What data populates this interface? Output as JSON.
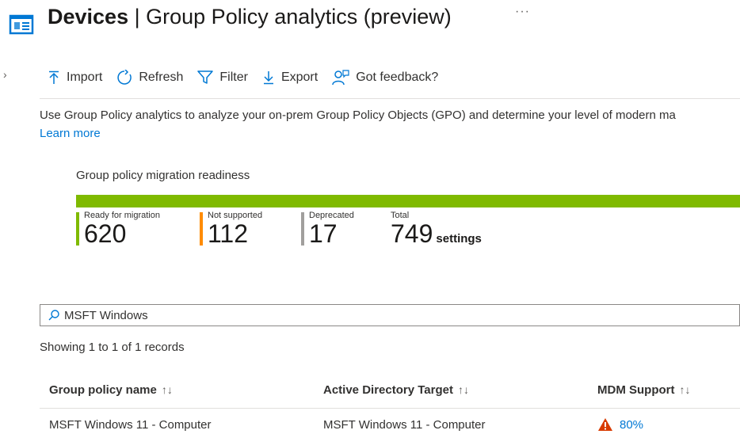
{
  "header": {
    "title_bold": "Devices",
    "separator": "|",
    "title_rest": "Group Policy analytics (preview)",
    "more": "···",
    "icon": "page-icon"
  },
  "nav": {
    "collapse_glyph": "›",
    "icon": "chevron-right-icon"
  },
  "toolbar": {
    "import_label": "Import",
    "refresh_label": "Refresh",
    "filter_label": "Filter",
    "export_label": "Export",
    "feedback_label": "Got feedback?"
  },
  "description": "Use Group Policy analytics to analyze your on-prem Group Policy Objects (GPO) and determine your level of modern ma",
  "learn_more": "Learn more",
  "readiness": {
    "title": "Group policy migration readiness",
    "ready_fraction": 1.0,
    "metrics": {
      "ready": {
        "label": "Ready for migration",
        "value": "620",
        "color": "#7fba00"
      },
      "not_supported": {
        "label": "Not supported",
        "value": "112",
        "color": "#ff8c00"
      },
      "deprecated": {
        "label": "Deprecated",
        "value": "17",
        "color": "#a19f9d"
      },
      "total": {
        "label": "Total",
        "value": "749",
        "unit": "settings"
      }
    }
  },
  "search": {
    "value": "MSFT Windows",
    "icon": "search-icon"
  },
  "records_text": "Showing 1 to 1 of 1 records",
  "table": {
    "columns": [
      {
        "label": "Group policy name",
        "sort": "↑↓"
      },
      {
        "label": "Active Directory Target",
        "sort": "↑↓"
      },
      {
        "label": "MDM Support",
        "sort": "↑↓"
      }
    ],
    "rows": [
      {
        "name": "MSFT Windows 11 - Computer",
        "target": "MSFT Windows 11 - Computer",
        "mdm_support": "80%",
        "mdm_icon": "warning-icon"
      }
    ]
  },
  "colors": {
    "accent": "#0078d4",
    "ready": "#7fba00",
    "not_supported": "#ff8c00",
    "deprecated": "#a19f9d",
    "warning": "#d83b01"
  }
}
